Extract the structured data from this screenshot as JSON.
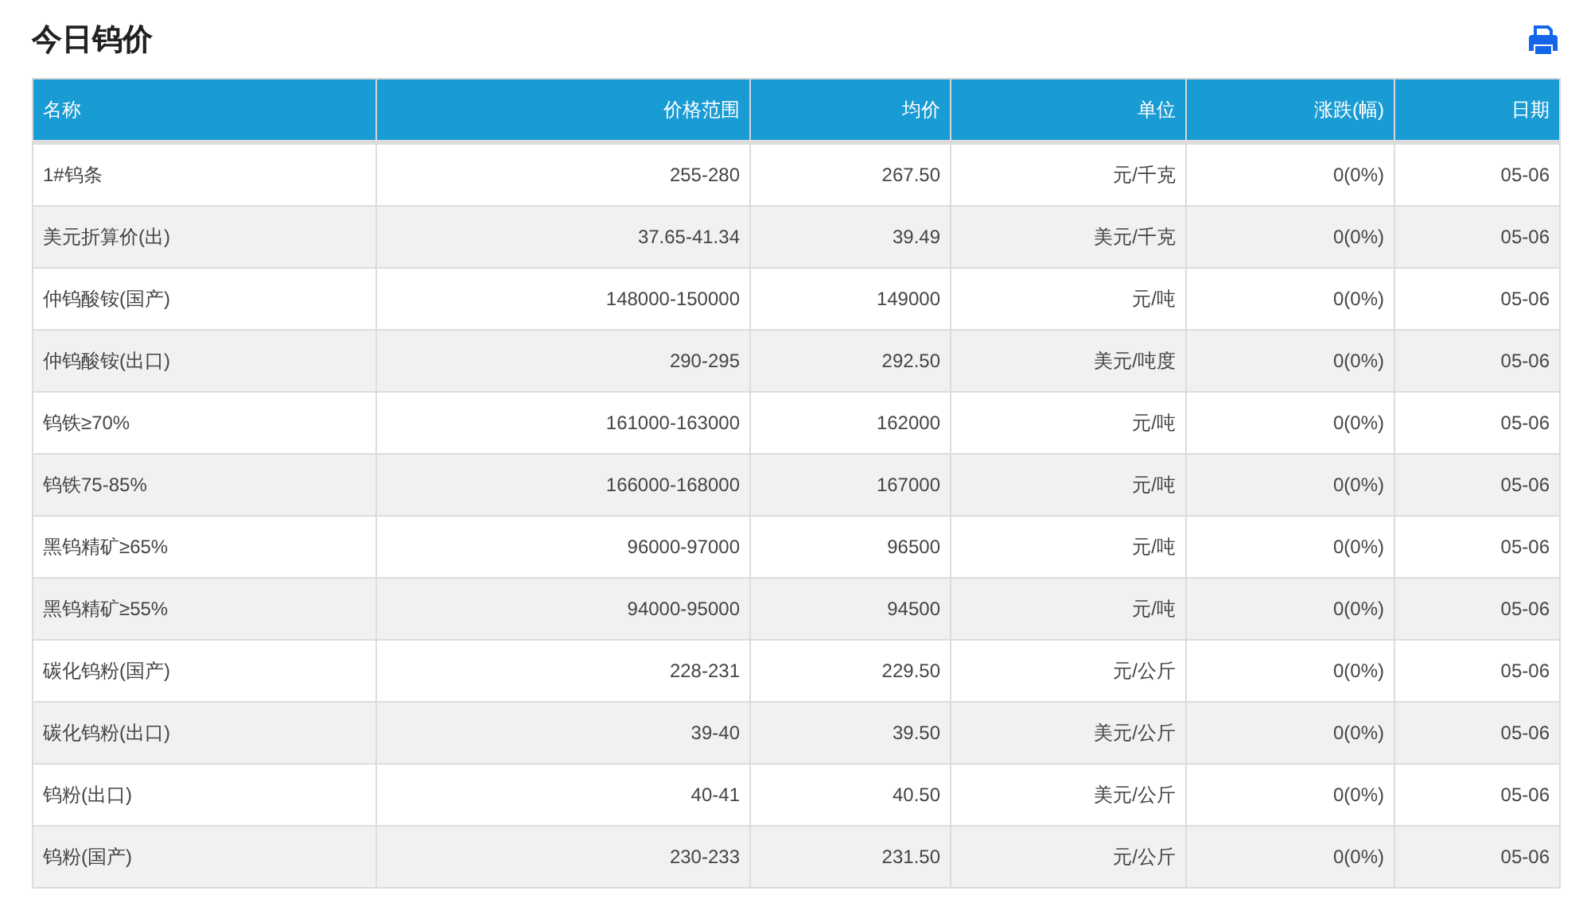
{
  "title": "今日钨价",
  "table": {
    "columns": [
      "名称",
      "价格范围",
      "均价",
      "单位",
      "涨跌(幅)",
      "日期"
    ],
    "rows": [
      [
        "1#钨条",
        "255-280",
        "267.50",
        "元/千克",
        "0(0%)",
        "05-06"
      ],
      [
        "美元折算价(出)",
        "37.65-41.34",
        "39.49",
        "美元/千克",
        "0(0%)",
        "05-06"
      ],
      [
        "仲钨酸铵(国产)",
        "148000-150000",
        "149000",
        "元/吨",
        "0(0%)",
        "05-06"
      ],
      [
        "仲钨酸铵(出口)",
        "290-295",
        "292.50",
        "美元/吨度",
        "0(0%)",
        "05-06"
      ],
      [
        "钨铁≥70%",
        "161000-163000",
        "162000",
        "元/吨",
        "0(0%)",
        "05-06"
      ],
      [
        "钨铁75-85%",
        "166000-168000",
        "167000",
        "元/吨",
        "0(0%)",
        "05-06"
      ],
      [
        "黑钨精矿≥65%",
        "96000-97000",
        "96500",
        "元/吨",
        "0(0%)",
        "05-06"
      ],
      [
        "黑钨精矿≥55%",
        "94000-95000",
        "94500",
        "元/吨",
        "0(0%)",
        "05-06"
      ],
      [
        "碳化钨粉(国产)",
        "228-231",
        "229.50",
        "元/公斤",
        "0(0%)",
        "05-06"
      ],
      [
        "碳化钨粉(出口)",
        "39-40",
        "39.50",
        "美元/公斤",
        "0(0%)",
        "05-06"
      ],
      [
        "钨粉(出口)",
        "40-41",
        "40.50",
        "美元/公斤",
        "0(0%)",
        "05-06"
      ],
      [
        "钨粉(国产)",
        "230-233",
        "231.50",
        "元/公斤",
        "0(0%)",
        "05-06"
      ]
    ]
  }
}
